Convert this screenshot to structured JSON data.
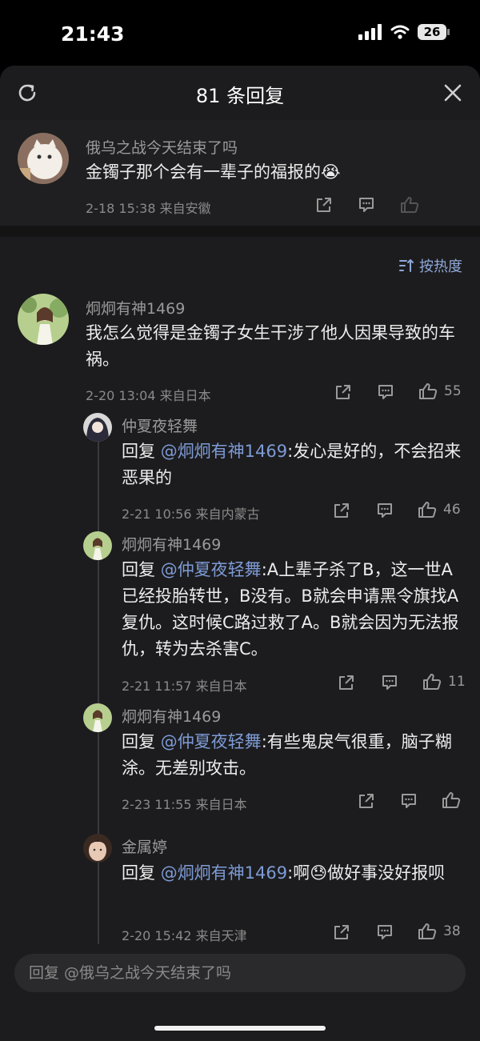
{
  "status": {
    "time": "21:43",
    "battery": "26"
  },
  "header": {
    "title": "81 条回复"
  },
  "root": {
    "username": "俄乌之战今天结束了吗",
    "text": "金镯子那个会有一辈子的福报的",
    "emoji": "😭",
    "meta": "2-18 15:38  来自安徽"
  },
  "sort": {
    "label": "按热度"
  },
  "comment": {
    "username": "炯炯有神1469",
    "text": "我怎么觉得是金镯子女生干涉了他人因果导致的车祸。",
    "meta": "2-20 13:04  来自日本",
    "likes": "55"
  },
  "replies": [
    {
      "username": "仲夏夜轻舞",
      "prefix": "回复 ",
      "mention": "@炯炯有神1469",
      "text": ":发心是好的，不会招来恶果的",
      "meta": "2-21 10:56  来自内蒙古",
      "likes": "46"
    },
    {
      "username": "炯炯有神1469",
      "prefix": "回复 ",
      "mention": "@仲夏夜轻舞",
      "text": ":A上辈子杀了B，这一世A已经投胎转世，B没有。B就会申请黑令旗找A复仇。这时候C路过救了A。B就会因为无法报仇，转为去杀害C。",
      "meta": "2-21 11:57  来自日本",
      "likes": "11"
    },
    {
      "username": "炯炯有神1469",
      "prefix": "回复 ",
      "mention": "@仲夏夜轻舞",
      "text": ":有些鬼戾气很重，脑子糊涂。无差别攻击。",
      "meta": "2-23 11:55  来自日本",
      "likes": ""
    },
    {
      "username": "金属婷",
      "prefix": "回复 ",
      "mention": "@炯炯有神1469",
      "text": ":啊",
      "emoji": "😓",
      "text2": "做好事没好报呗",
      "meta": "2-20 15:42  来自天津",
      "likes": "38"
    }
  ],
  "reply_bar": {
    "placeholder": "回复 @俄乌之战今天结束了吗"
  },
  "icons": [
    "refresh-icon",
    "close-icon",
    "share-icon",
    "comment-icon",
    "like-icon",
    "sort-icon",
    "signal-icon",
    "wifi-icon"
  ]
}
